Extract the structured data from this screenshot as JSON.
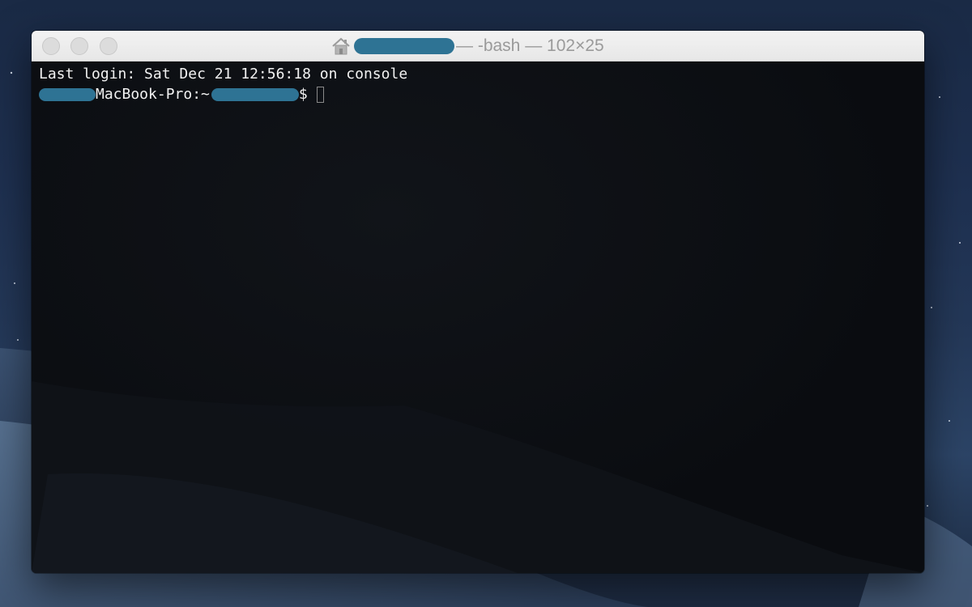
{
  "window": {
    "title_suffix": "— -bash — 102×25",
    "home_icon": "house-icon"
  },
  "terminal": {
    "last_login": "Last login: Sat Dec 21 12:56:18 on console",
    "prompt_host": "MacBook-Pro:~",
    "prompt_symbol": "$"
  },
  "colors": {
    "redaction": "#2e7394",
    "terminal_bg": "#0c0e13",
    "terminal_text": "#f2f2f2"
  }
}
